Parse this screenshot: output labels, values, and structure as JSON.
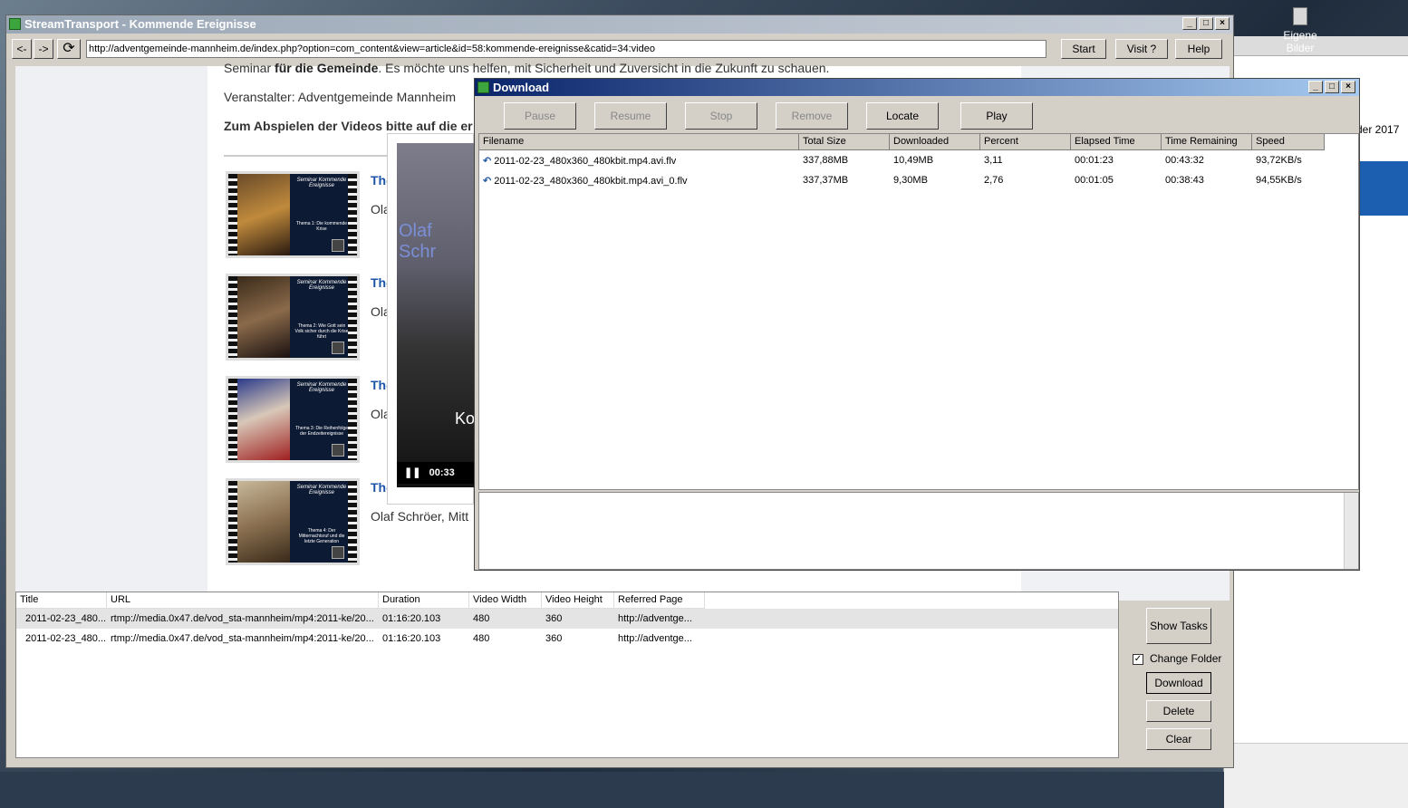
{
  "desktop": {
    "icon_label": "Eigene Bilder",
    "bg_text": "der 2017"
  },
  "main": {
    "title": "StreamTransport - Kommende Ereignisse",
    "back_label": "<-",
    "fwd_label": "->",
    "url": "http://adventgemeinde-mannheim.de/index.php?option=com_content&view=article&id=58:kommende-ereignisse&catid=34:video",
    "start_label": "Start",
    "visit_label": "Visit ?",
    "help_label": "Help"
  },
  "web": {
    "line1_pre": "Seminar ",
    "line1_bold": "für die Gemeinde",
    "line1_post": ". Es möchte uns helfen, mit Sicherheit und Zuversicht  in die Zukunft zu schauen.",
    "organizer": "Veranstalter: Adventgemeinde Mannheim",
    "play_hint": "Zum Abspielen der Videos bitte auf die er",
    "videos": [
      {
        "title": "The",
        "sub": "Ola",
        "thumb_head": "Seminar Kommende Ereignisse",
        "thumb_topic": "Thema 1: Die kommende Krise"
      },
      {
        "title": "The",
        "sub": "Ola",
        "thumb_head": "Seminar Kommende Ereignisse",
        "thumb_topic": "Thema 2: Wie Gott sein Volk sicher durch die Krise führt"
      },
      {
        "title": "The",
        "sub": "Ola",
        "thumb_head": "Seminar Kommende Ereignisse",
        "thumb_topic": "Thema 3: Die Reihenfolge der Endzeitereignisse"
      },
      {
        "title": "The",
        "sub": "Olaf Schröer, Mitt",
        "thumb_head": "Seminar Kommende Ereignisse",
        "thumb_topic": "Thema 4: Der Mitternachtsruf und die letzte Generation"
      }
    ],
    "player": {
      "name": "Olaf Schr",
      "overlay": "Ko",
      "time": "00:33"
    }
  },
  "download": {
    "title": "Download",
    "buttons": {
      "pause": "Pause",
      "resume": "Resume",
      "stop": "Stop",
      "remove": "Remove",
      "locate": "Locate",
      "play": "Play"
    },
    "columns": [
      "Filename",
      "Total Size",
      "Downloaded",
      "Percent",
      "Elapsed Time",
      "Time Remaining",
      "Speed"
    ],
    "rows": [
      [
        "2011-02-23_480x360_480kbit.mp4.avi.flv",
        "337,88MB",
        "10,49MB",
        "3,11",
        "00:01:23",
        "00:43:32",
        "93,72KB/s"
      ],
      [
        "2011-02-23_480x360_480kbit.mp4.avi_0.flv",
        "337,37MB",
        "9,30MB",
        "2,76",
        "00:01:05",
        "00:38:43",
        "94,55KB/s"
      ]
    ]
  },
  "list": {
    "columns": [
      "Title",
      "URL",
      "Duration",
      "Video Width",
      "Video Height",
      "Referred Page"
    ],
    "rows": [
      [
        "2011-02-23_480...",
        "rtmp://media.0x47.de/vod_sta-mannheim/mp4:2011-ke/20...",
        "01:16:20.103",
        "480",
        "360",
        "http://adventge..."
      ],
      [
        "2011-02-23_480...",
        "rtmp://media.0x47.de/vod_sta-mannheim/mp4:2011-ke/20...",
        "01:16:20.103",
        "480",
        "360",
        "http://adventge..."
      ]
    ]
  },
  "side": {
    "show_tasks": "Show Tasks",
    "change_folder": "Change Folder",
    "change_folder_checked": true,
    "download": "Download",
    "delete": "Delete",
    "clear": "Clear"
  }
}
